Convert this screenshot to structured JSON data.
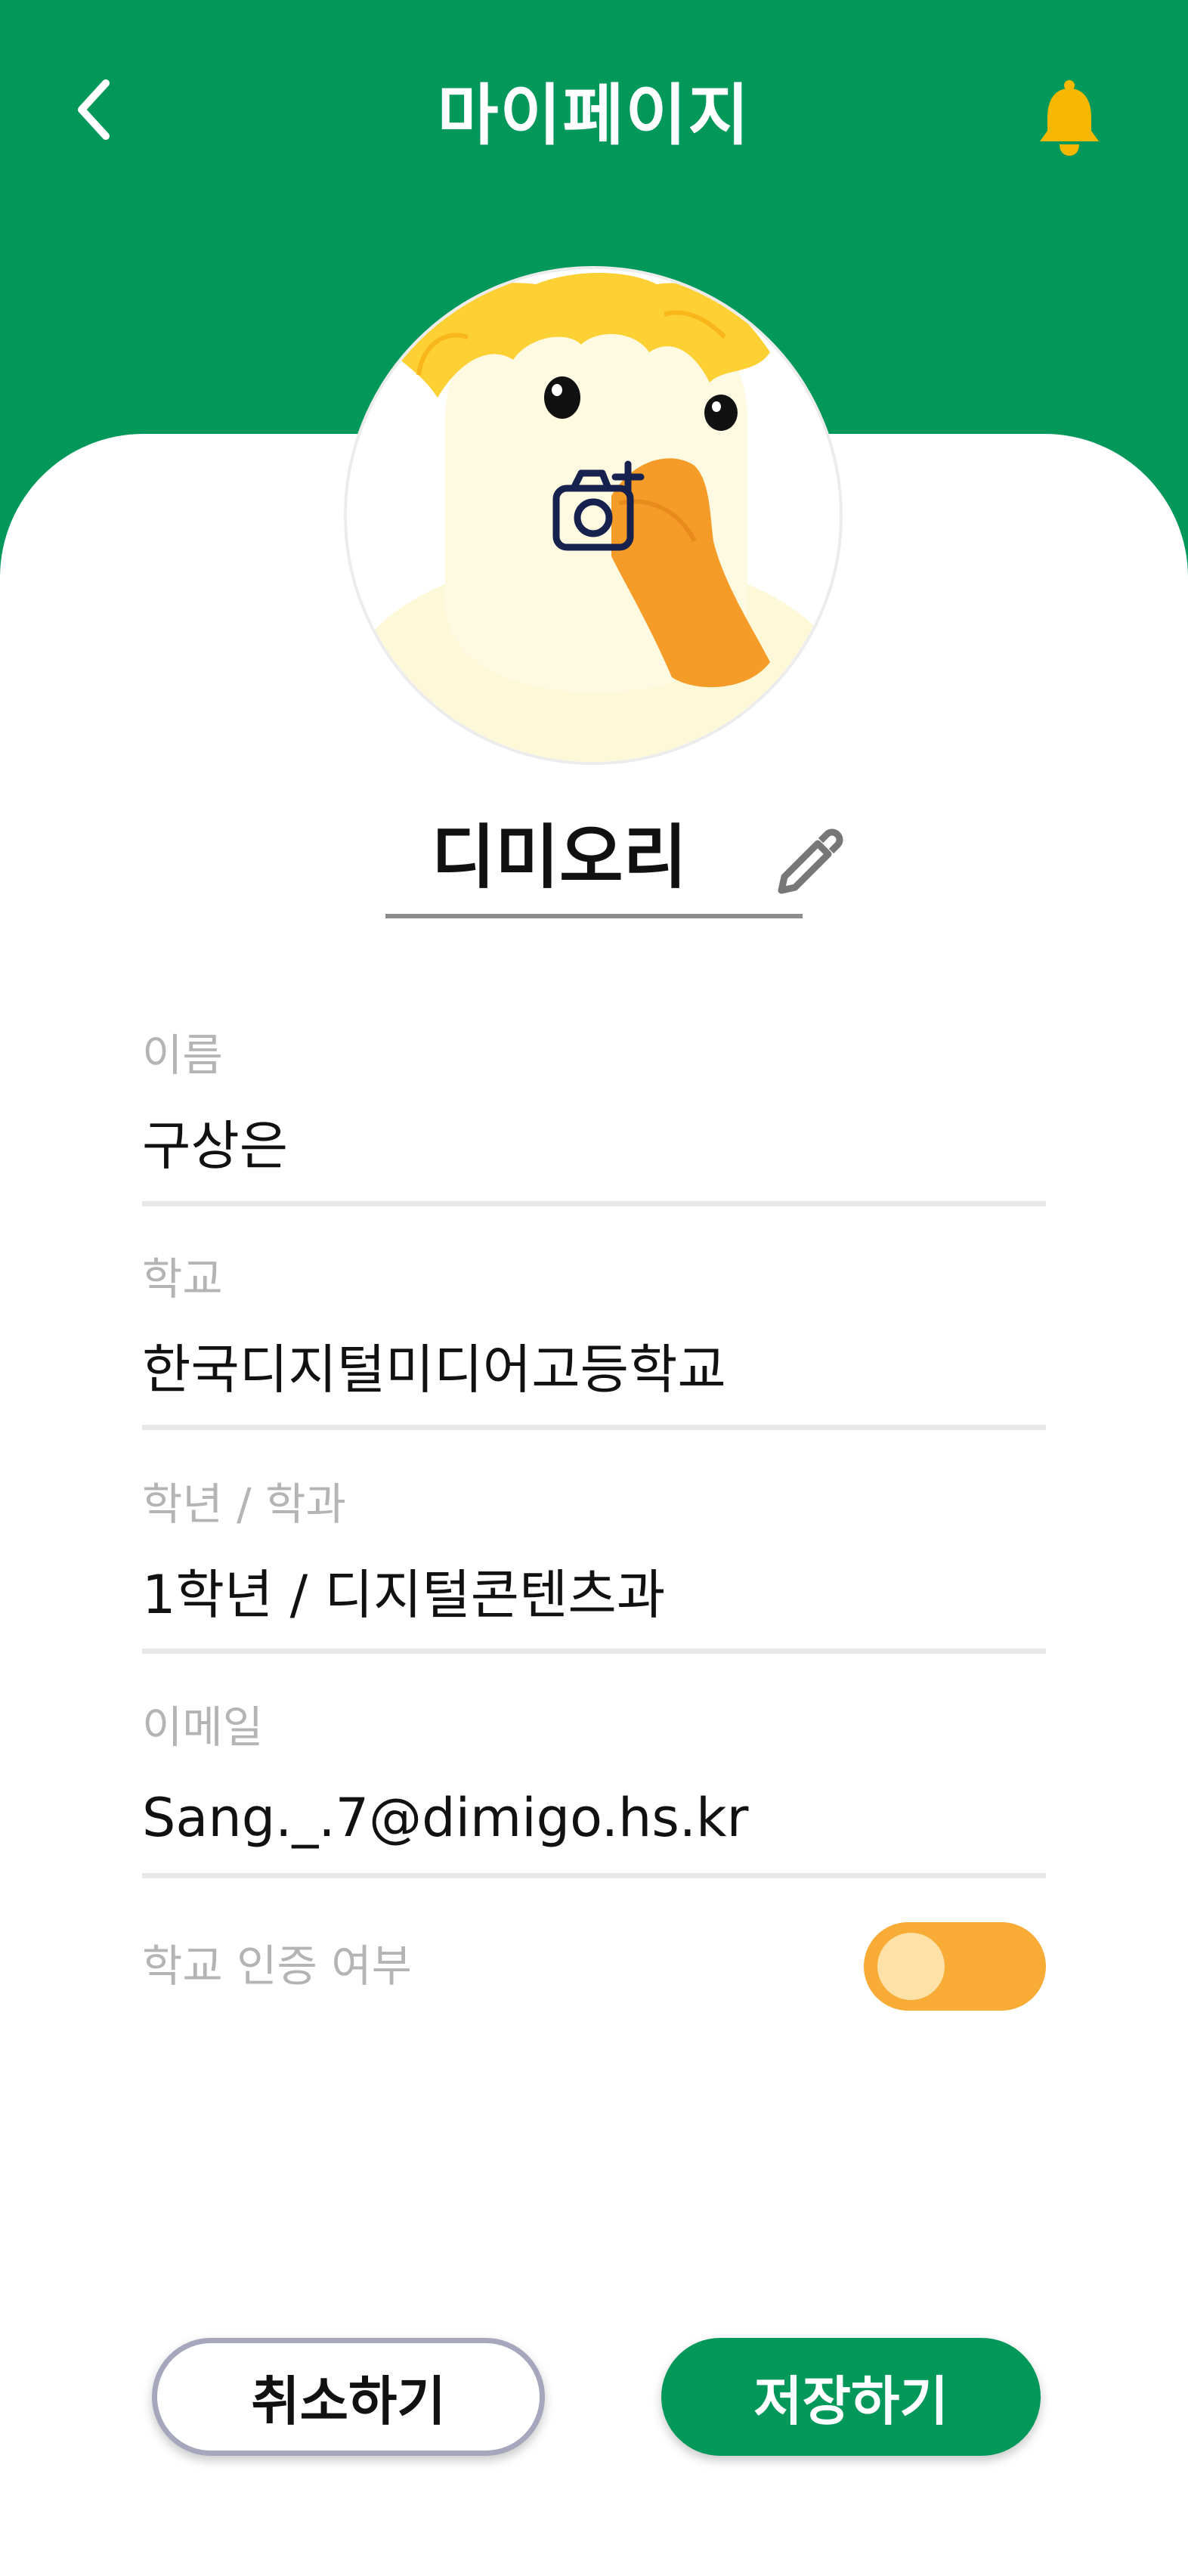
{
  "header": {
    "title": "마이페이지",
    "back_icon": "chevron-left-icon",
    "notification_icon": "bell-icon"
  },
  "profile": {
    "avatar_icon": "camera-add-icon",
    "nickname": "디미오리",
    "edit_icon": "pencil-icon"
  },
  "fields": [
    {
      "label": "이름",
      "value": "구상은"
    },
    {
      "label": "학교",
      "value": "한국디지털미디어고등학교"
    },
    {
      "label": "학년 / 학과",
      "value": "1학년 / 디지털콘텐츠과"
    },
    {
      "label": "이메일",
      "value": "Sang._.7@dimigo.hs.kr"
    }
  ],
  "verification": {
    "label": "학교 인증 여부",
    "enabled": true
  },
  "actions": {
    "cancel_label": "취소하기",
    "save_label": "저장하기"
  },
  "colors": {
    "brand_green": "#02985A",
    "accent_orange": "#F8AC35",
    "bell_yellow": "#F6B800"
  }
}
